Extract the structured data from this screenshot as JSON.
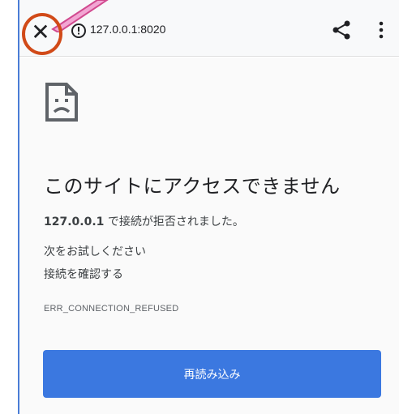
{
  "browser": {
    "url": "127.0.0.1:8020",
    "close_icon": "close-icon",
    "info_icon": "info-icon",
    "share_icon": "share-icon",
    "menu_icon": "more-vert-icon"
  },
  "error_page": {
    "icon": "sad-page-icon",
    "heading": "このサイトにアクセスできません",
    "description_host": "127.0.0.1",
    "description_rest": " で接続が拒否されました。",
    "try_title": "次をお試しください",
    "try_items": [
      "接続を確認する"
    ],
    "error_code": "ERR_CONNECTION_REFUSED",
    "reload_label": "再読み込み"
  },
  "annotation": {
    "circle_color": "#d14a18",
    "arrow_color": "#e84aa0"
  },
  "colors": {
    "accent": "#3b78e0",
    "toolbar_bg": "#f8f9fa",
    "page_bg": "#fafafa"
  }
}
